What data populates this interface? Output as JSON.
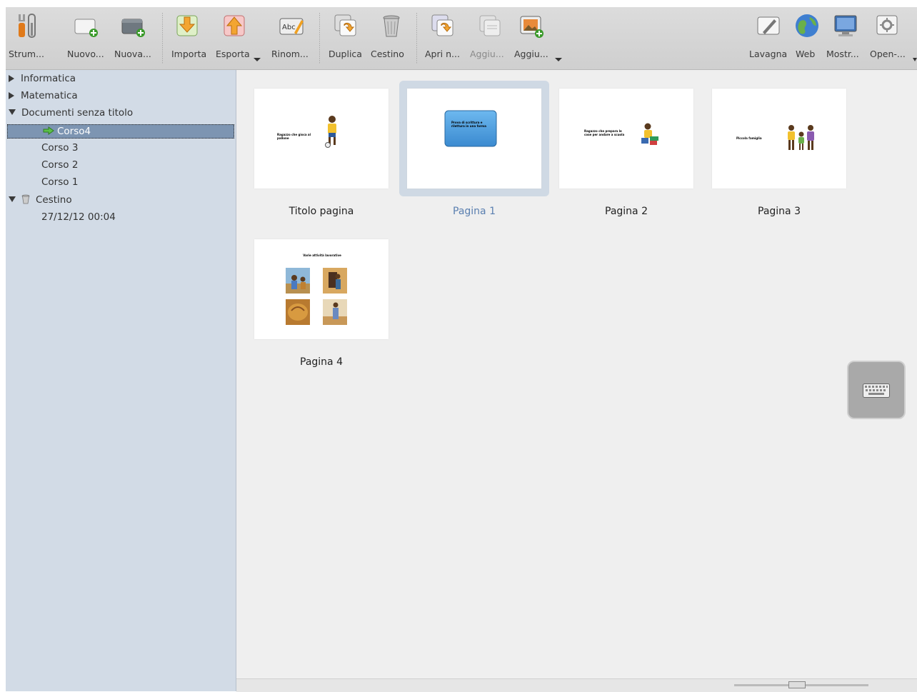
{
  "toolbar": {
    "tools": "Strum...",
    "new_doc": "Nuovo...",
    "new_folder": "Nuova...",
    "import": "Importa",
    "export": "Esporta",
    "rename": "Rinom...",
    "duplicate": "Duplica",
    "trash": "Cestino",
    "open": "Apri n...",
    "add1": "Aggiu...",
    "add2": "Aggiu...",
    "board": "Lavagna",
    "web": "Web",
    "show": "Mostr...",
    "open_sankore": "Open-..."
  },
  "sidebar": {
    "items": [
      {
        "label": "Informatica"
      },
      {
        "label": "Matematica"
      },
      {
        "label": "Documenti senza titolo"
      },
      {
        "label": "Corso4"
      },
      {
        "label": "Corso 3"
      },
      {
        "label": "Corso 2"
      },
      {
        "label": "Corso 1"
      },
      {
        "label": "Cestino"
      },
      {
        "label": "27/12/12 00:04"
      }
    ]
  },
  "pages": [
    {
      "label": "Titolo pagina",
      "text": "Ragazzo che gioca al pallone"
    },
    {
      "label": "Pagina 1",
      "text": "Prova di scrittura e rilettura in una forma"
    },
    {
      "label": "Pagina 2",
      "text": "Ragazzo che prepara le cose per andare a scuola"
    },
    {
      "label": "Pagina 3",
      "text": "Piccola famiglia"
    },
    {
      "label": "Pagina 4",
      "text": "Varie attività lavorative"
    }
  ],
  "colors": {
    "sidebar_bg": "#d2dbe6",
    "selection": "#7d95b2",
    "selected_label": "#5a7fb0"
  }
}
